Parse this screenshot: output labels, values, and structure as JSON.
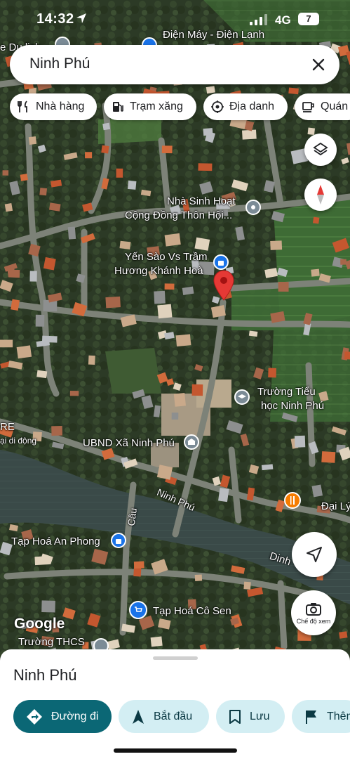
{
  "status_bar": {
    "time": "14:32",
    "network": "4G",
    "battery": "7"
  },
  "search": {
    "query": "Ninh Phú"
  },
  "chips": [
    {
      "label": "Nhà hàng",
      "icon": "fork-knife-icon"
    },
    {
      "label": "Trạm xăng",
      "icon": "gas-station-icon"
    },
    {
      "label": "Địa danh",
      "icon": "landmark-icon"
    },
    {
      "label": "Quán",
      "icon": "coffee-icon"
    }
  ],
  "map_labels": {
    "top_store": "Điện Máy - Điện Lạnh",
    "top_left_partial": "e Du lịch",
    "community_house": [
      "Nhà Sinh Hoạt",
      "Cộng Đồng Thôn Hội..."
    ],
    "yen_sao": [
      "Yến Sào Vs Trầm",
      "Hương Khánh Hoà"
    ],
    "school": [
      "Trường Tiểu",
      "học Ninh Phú"
    ],
    "left_partial_1": "RE",
    "left_partial_2": "ại di động",
    "ubnd": "UBND Xã Ninh Phú",
    "road_ninh_phu": "Ninh Phú",
    "bridge": "Cầu",
    "dai_ly": "Đại Lý",
    "dinh": "Dinh",
    "tap_hoa_an_phong": "Tạp Hoá An Phong",
    "tap_hoa_co_sen": "Tạp Hoá Cô Sen",
    "truong_thcs": "Trường THCS",
    "google_logo": "Google"
  },
  "controls": {
    "street_view_label": "Chế độ xem"
  },
  "sheet": {
    "place_name": "Ninh Phú",
    "buttons": [
      {
        "label": "Đường đi",
        "primary": true
      },
      {
        "label": "Bắt đầu",
        "primary": false
      },
      {
        "label": "Lưu",
        "primary": false
      },
      {
        "label": "Thêm",
        "primary": false
      }
    ]
  },
  "colors": {
    "primary": "#0b6775",
    "secondary_bg": "#d3eef3",
    "pin": "#e53935",
    "poi_blue": "#1a73e8",
    "poi_gray": "#7b8b96",
    "poi_orange": "#f57c00"
  }
}
